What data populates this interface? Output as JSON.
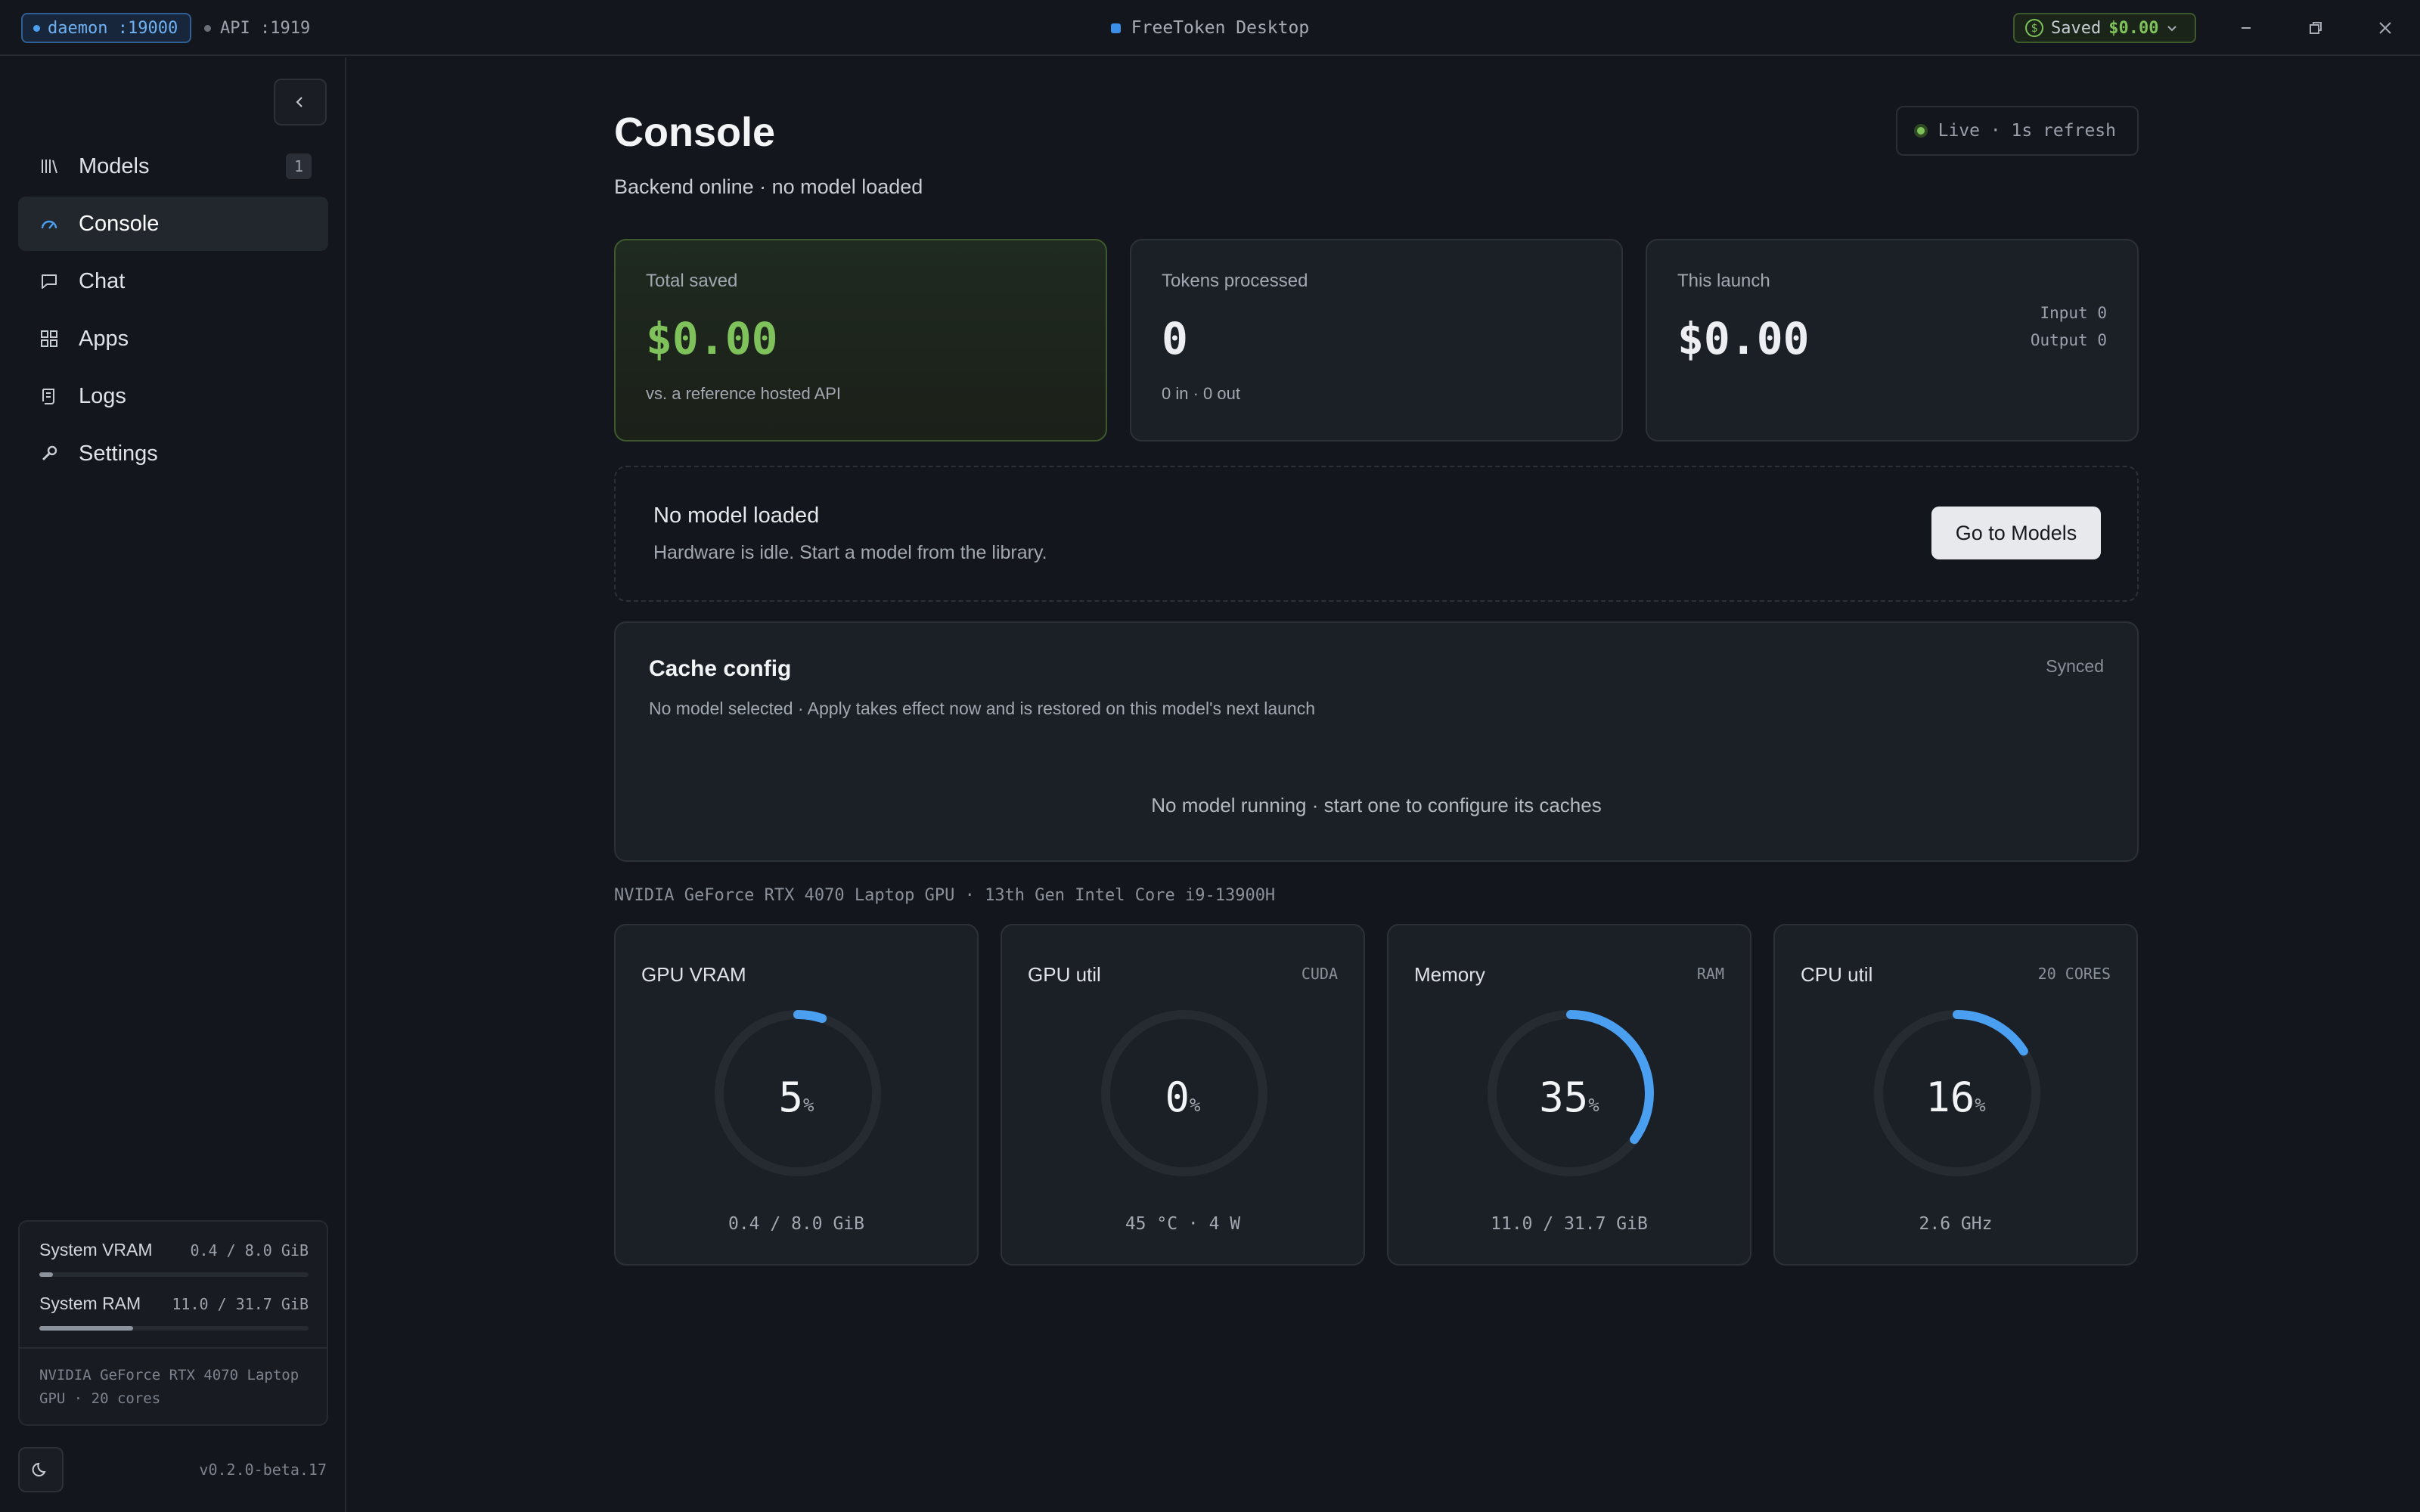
{
  "titlebar": {
    "daemon": "daemon :19000",
    "api": "API :1919",
    "app_title": "FreeToken Desktop",
    "saved_label": "Saved",
    "saved_amount": "$0.00"
  },
  "sidebar": {
    "items": [
      {
        "label": "Models",
        "icon": "library-icon",
        "badge": "1"
      },
      {
        "label": "Console",
        "icon": "gauge-icon",
        "active": true
      },
      {
        "label": "Chat",
        "icon": "chat-icon"
      },
      {
        "label": "Apps",
        "icon": "grid-icon"
      },
      {
        "label": "Logs",
        "icon": "scroll-icon"
      },
      {
        "label": "Settings",
        "icon": "wrench-icon"
      }
    ],
    "system": {
      "vram_label": "System VRAM",
      "vram_value": "0.4 / 8.0 GiB",
      "vram_fraction": 0.05,
      "ram_label": "System RAM",
      "ram_value": "11.0 / 31.7 GiB",
      "ram_fraction": 0.347,
      "hardware": "NVIDIA GeForce RTX 4070 Laptop GPU · 20 cores"
    },
    "version": "v0.2.0-beta.17"
  },
  "main": {
    "title": "Console",
    "subtitle": "Backend online · no model loaded",
    "live": "Live · 1s refresh",
    "stats": {
      "total_saved": {
        "label": "Total saved",
        "value": "$0.00",
        "sub": "vs. a reference hosted API"
      },
      "tokens": {
        "label": "Tokens processed",
        "value": "0",
        "sub": "0 in · 0 out"
      },
      "launch": {
        "label": "This launch",
        "value": "$0.00",
        "input": "Input 0",
        "output": "Output 0"
      }
    },
    "no_model": {
      "title": "No model loaded",
      "desc": "Hardware is idle. Start a model from the library.",
      "button": "Go to Models"
    },
    "cache": {
      "title": "Cache config",
      "desc": "No model selected · Apply takes effect now and is restored on this model's next launch",
      "status": "Synced",
      "empty": "No model running · start one to configure its caches"
    },
    "hardware_line": "NVIDIA GeForce RTX 4070 Laptop GPU · 13th Gen Intel Core i9-13900H",
    "gauges": [
      {
        "label": "GPU VRAM",
        "tag": "",
        "percent": 5,
        "unit": "%",
        "footer": "0.4 / 8.0 GiB"
      },
      {
        "label": "GPU util",
        "tag": "CUDA",
        "percent": 0,
        "unit": "%",
        "footer": "45 °C · 4 W"
      },
      {
        "label": "Memory",
        "tag": "RAM",
        "percent": 35,
        "unit": "%",
        "footer": "11.0 / 31.7 GiB"
      },
      {
        "label": "CPU util",
        "tag": "20 CORES",
        "percent": 16,
        "unit": "%",
        "footer": "2.6 GHz"
      }
    ]
  },
  "colors": {
    "accent_blue": "#4a9ff0",
    "accent_green": "#7fc15a",
    "background": "#13161c",
    "card": "#1b1f26"
  }
}
